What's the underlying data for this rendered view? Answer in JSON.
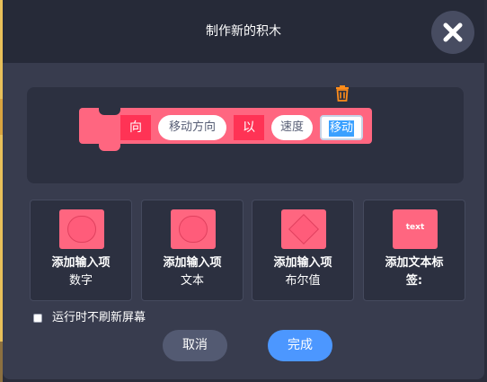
{
  "dialog": {
    "title": "制作新的积木",
    "close_icon": "close-x-icon"
  },
  "block": {
    "delete_icon": "trash-icon",
    "parts": [
      {
        "type": "label",
        "text": "向"
      },
      {
        "type": "input",
        "text": "移动方向"
      },
      {
        "type": "label",
        "text": "以"
      },
      {
        "type": "input",
        "text": "速度"
      },
      {
        "type": "editing-label",
        "text": "移动"
      }
    ]
  },
  "options": [
    {
      "title": "添加输入项",
      "subtitle": "数字",
      "icon": "number-input-icon"
    },
    {
      "title": "添加输入项",
      "subtitle": "文本",
      "icon": "text-input-icon"
    },
    {
      "title": "添加输入项",
      "subtitle": "布尔值",
      "icon": "boolean-input-icon"
    },
    {
      "title": "添加文本标",
      "subtitle": "签:",
      "icon": "text-label-icon",
      "icon_text": "text"
    }
  ],
  "run_without_refresh": {
    "label": "运行时不刷新屏幕",
    "checked": false
  },
  "buttons": {
    "cancel": "取消",
    "ok": "完成"
  },
  "colors": {
    "block": "#ff6680",
    "block_label_bg": "#ff3355",
    "primary_button": "#4c97ff",
    "secondary_button": "#535a72",
    "selection": "#3aa0ff"
  }
}
